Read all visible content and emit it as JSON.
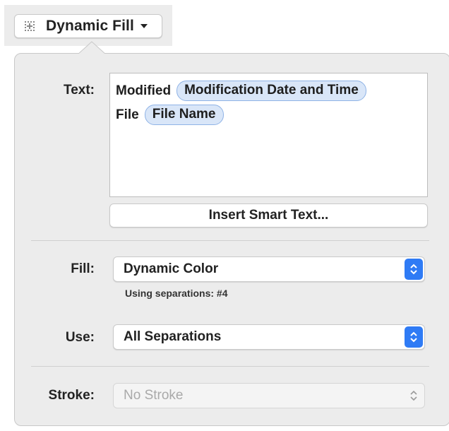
{
  "header": {
    "popup_label": "Dynamic Fill",
    "popup_icon": "grid-dots-icon"
  },
  "text_section": {
    "label": "Text:",
    "lines": [
      {
        "prefix": "Modified",
        "token": "Modification Date and Time"
      },
      {
        "prefix": "File",
        "token": "File Name"
      }
    ],
    "insert_button_label": "Insert Smart Text..."
  },
  "fill_section": {
    "label": "Fill:",
    "selected": "Dynamic Color",
    "note": "Using separations: #4"
  },
  "use_section": {
    "label": "Use:",
    "selected": "All Separations"
  },
  "stroke_section": {
    "label": "Stroke:",
    "selected": "No Stroke",
    "disabled": true
  },
  "colors": {
    "accent": "#2f7bf5",
    "token_bg": "#d9e6f8",
    "token_border": "#8fb3e6",
    "panel_bg": "#ececec"
  }
}
